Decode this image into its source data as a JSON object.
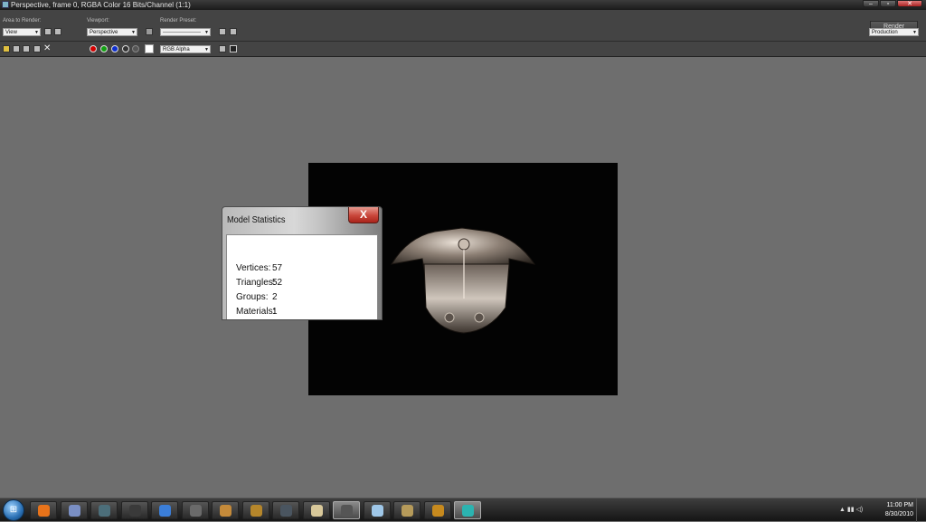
{
  "window": {
    "title": "Perspective, frame 0, RGBA Color 16 Bits/Channel (1:1)",
    "controls": [
      "–",
      "▫",
      "✕"
    ]
  },
  "toolbar": {
    "area_label": "Area to Render:",
    "area_value": "View",
    "viewport_label": "Viewport:",
    "viewport_value": "Perspective",
    "preset_label": "Render Preset:",
    "preset_value": "---------------------",
    "render_button": "Render",
    "production_value": "Production",
    "channel_value": "RGB Alpha",
    "channel_colors": [
      "#d40000",
      "#12a012",
      "#1030d0"
    ]
  },
  "dialog": {
    "title": "Model Statistics",
    "close_label": "X",
    "stats": [
      {
        "label": "Vertices:",
        "value": "57"
      },
      {
        "label": "Triangles:",
        "value": "52"
      },
      {
        "label": "Groups:",
        "value": "2"
      },
      {
        "label": "Materials:",
        "value": "1"
      }
    ]
  },
  "taskbar": {
    "start_label": "⊞",
    "apps": [
      {
        "name": "firefox-icon",
        "color": "#e8731a"
      },
      {
        "name": "app-diamond-icon",
        "color": "#7a8fc4"
      },
      {
        "name": "starcraft-icon",
        "color": "#4c6e7a"
      },
      {
        "name": "app-shield-icon",
        "color": "#3a3a3a"
      },
      {
        "name": "app-blue-icon",
        "color": "#3b7ed8"
      },
      {
        "name": "app-emblem-icon",
        "color": "#6a6a6a"
      },
      {
        "name": "app-portrait-icon",
        "color": "#c48a3a"
      },
      {
        "name": "app-gold-icon",
        "color": "#b5862b"
      },
      {
        "name": "app-dark-icon",
        "color": "#4a5560"
      },
      {
        "name": "app-skull-icon",
        "color": "#d8c89a"
      },
      {
        "name": "app-grey-icon",
        "color": "#555"
      },
      {
        "name": "app-window-icon",
        "color": "#9fc7e8"
      },
      {
        "name": "app-scroll-icon",
        "color": "#b59a5a"
      },
      {
        "name": "app-flame-icon",
        "color": "#c78a1e"
      },
      {
        "name": "app-swirl-icon",
        "color": "#2bb3b0"
      }
    ],
    "tray_icons": "▲  ▮▮  ◁)",
    "time": "11:00 PM",
    "date": "8/30/2010"
  }
}
